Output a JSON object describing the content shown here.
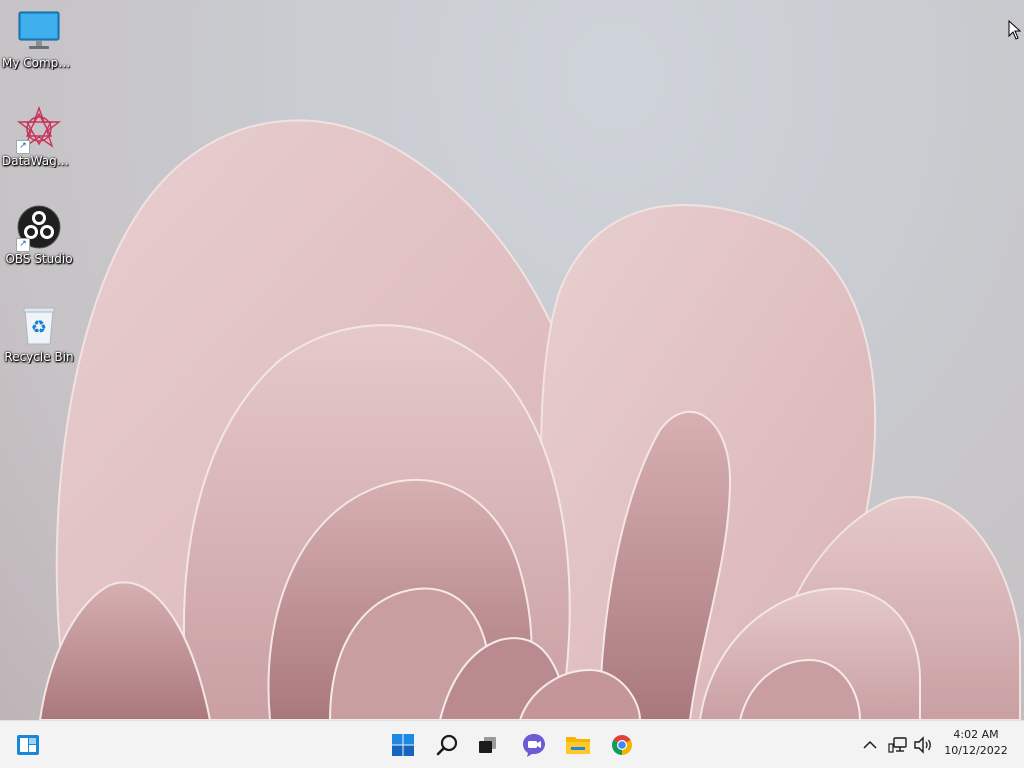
{
  "desktop": {
    "icons": [
      {
        "label": "My Computer",
        "icon": "monitor-icon"
      },
      {
        "label": "DataWagon...",
        "icon": "datawagon-icon"
      },
      {
        "label": "OBS Studio",
        "icon": "obs-icon"
      },
      {
        "label": "Recycle Bin",
        "icon": "recycle-bin-icon"
      }
    ]
  },
  "taskbar": {
    "widgets_icon": "widgets-icon",
    "apps": [
      {
        "icon": "windows-start-icon"
      },
      {
        "icon": "search-icon"
      },
      {
        "icon": "task-view-icon"
      },
      {
        "icon": "chat-icon"
      },
      {
        "icon": "file-explorer-icon"
      },
      {
        "icon": "chrome-icon"
      }
    ],
    "tray": {
      "icons": [
        "chevron-up-icon",
        "network-icon",
        "volume-icon"
      ]
    },
    "clock": {
      "time": "4:02 AM",
      "date": "10/12/2022"
    }
  },
  "colors": {
    "taskbar_bg": "#f3f3f3",
    "accent": "#0078d4",
    "petal": "#e3c5c6"
  }
}
